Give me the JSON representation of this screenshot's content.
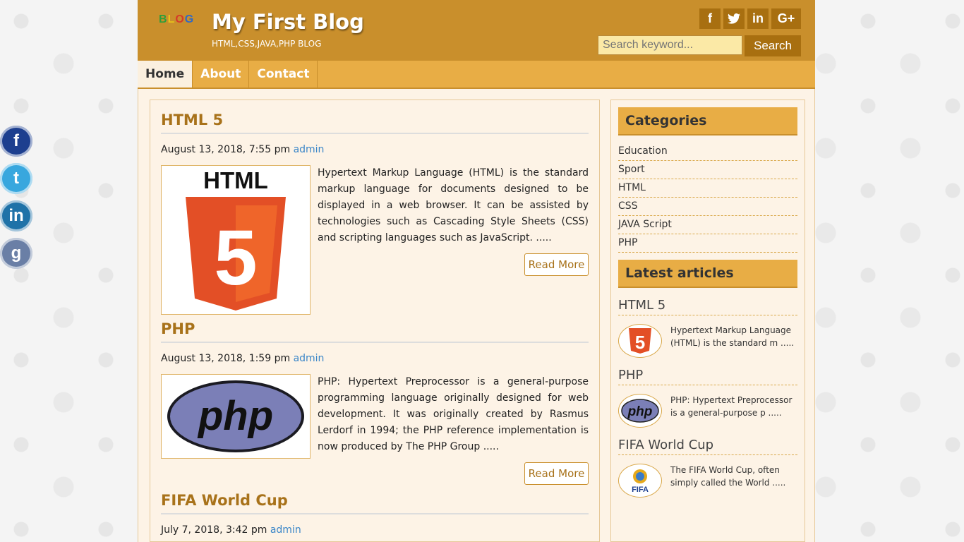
{
  "left_social": [
    "facebook",
    "twitter",
    "linkedin",
    "google-plus"
  ],
  "header": {
    "logo_text": "BLOG",
    "title": "My First Blog",
    "subtitle": "HTML,CSS,JAVA,PHP BLOG",
    "social": {
      "facebook": "f",
      "twitter": "🐦",
      "linkedin": "in",
      "google": "G+"
    },
    "search": {
      "placeholder": "Search keyword...",
      "button": "Search"
    }
  },
  "nav": {
    "home": "Home",
    "about": "About",
    "contact": "Contact"
  },
  "posts": [
    {
      "title": "HTML 5",
      "date": "August 13, 2018, 7:55 pm",
      "author": "admin",
      "excerpt": "Hypertext Markup Language (HTML) is the standard markup language for documents designed to be displayed in a web browser. It can be assisted by technologies such as Cascading Style Sheets (CSS) and scripting languages such as JavaScript. .....",
      "read_more": "Read More",
      "image_text": "HTML",
      "image_number": "5"
    },
    {
      "title": "PHP",
      "date": "August 13, 2018, 1:59 pm",
      "author": "admin",
      "excerpt": "PHP: Hypertext Preprocessor is a general-purpose programming language originally designed for web development. It was originally created by Rasmus Lerdorf in 1994; the PHP reference implementation is now produced by The PHP Group .....",
      "read_more": "Read More",
      "image_text": "php"
    },
    {
      "title": "FIFA World Cup",
      "date": "July 7, 2018, 3:42 pm",
      "author": "admin"
    }
  ],
  "sidebar": {
    "categories_title": "Categories",
    "categories": [
      "Education",
      "Sport",
      "HTML",
      "CSS",
      "JAVA Script",
      "PHP"
    ],
    "latest_title": "Latest articles",
    "latest": [
      {
        "title": "HTML 5",
        "snippet": "Hypertext Markup Language (HTML) is the standard m .....",
        "thumb": "5"
      },
      {
        "title": "PHP",
        "snippet": "PHP: Hypertext Preprocessor is a general-purpose p .....",
        "thumb": "php"
      },
      {
        "title": "FIFA World Cup",
        "snippet": "The FIFA World Cup, often simply called the World .....",
        "thumb": "FIFA"
      }
    ]
  }
}
